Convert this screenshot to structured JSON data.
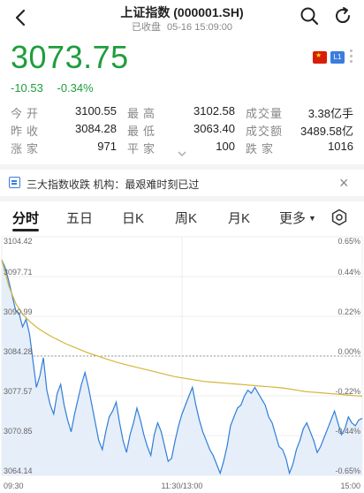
{
  "header": {
    "title": "上证指数 (000001.SH)",
    "status": "已收盘",
    "datetime": "05-16 15:09:00"
  },
  "quote": {
    "price": "3073.75",
    "change": "-10.53",
    "change_pct": "-0.34%",
    "badge_level": "L1"
  },
  "stats": [
    {
      "l1": "今开",
      "v1": "3100.55",
      "l2": "最高",
      "v2": "3102.58",
      "l3": "成交量",
      "v3": "3.38亿手"
    },
    {
      "l1": "昨收",
      "v1": "3084.28",
      "l2": "最低",
      "v2": "3063.40",
      "l3": "成交额",
      "v3": "3489.58亿"
    },
    {
      "l1": "涨家",
      "v1": "971",
      "l2": "平家",
      "v2": "100",
      "l3": "跌家",
      "v3": "1016"
    }
  ],
  "news": {
    "text": "三大指数收跌 机构：最艰难时刻已过"
  },
  "tabs": [
    "分时",
    "五日",
    "日K",
    "周K",
    "月K",
    "更多"
  ],
  "colors": {
    "down": "#1e9e3c",
    "price_line": "#2f7ed8",
    "avg_line": "#d4b63a",
    "fill": "#e6eef9"
  },
  "chart_data": {
    "type": "line",
    "y_left_ticks": [
      "3104.42",
      "3097.71",
      "3090.99",
      "3084.28",
      "3077.57",
      "3070.85",
      "3064.14"
    ],
    "y_right_ticks": [
      "0.65%",
      "0.44%",
      "0.22%",
      "0.00%",
      "-0.22%",
      "-0.44%",
      "-0.65%"
    ],
    "x_ticks": [
      "09:30",
      "11:30/13:00",
      "15:00"
    ],
    "ylim": [
      3064.14,
      3104.42
    ],
    "prev_close": 3084.28,
    "series": [
      {
        "values": [
          3100.5,
          3099.2,
          3097.0,
          3094.5,
          3092.0,
          3091.5,
          3089.2,
          3090.5,
          3088.0,
          3083.5,
          3079.0,
          3081.0,
          3084.0,
          3078.5,
          3076.0,
          3074.5,
          3078.0,
          3079.5,
          3076.0,
          3073.5,
          3071.5,
          3074.5,
          3077.0,
          3079.5,
          3081.5,
          3079.0,
          3076.0,
          3073.0,
          3070.0,
          3068.5,
          3071.5,
          3074.0,
          3075.0,
          3076.5,
          3073.0,
          3070.0,
          3068.0,
          3071.0,
          3073.0,
          3075.5,
          3073.5,
          3071.0,
          3069.0,
          3067.5,
          3071.0,
          3073.0,
          3071.5,
          3069.0,
          3066.5,
          3067.0,
          3070.0,
          3072.5,
          3074.5,
          3076.0,
          3077.5,
          3079.0,
          3076.0,
          3073.5,
          3071.5,
          3070.0,
          3068.5,
          3067.5,
          3066.0,
          3064.5,
          3066.5,
          3069.0,
          3072.5,
          3074.0,
          3075.5,
          3076.0,
          3077.5,
          3078.5,
          3078.0,
          3079.0,
          3078.0,
          3077.0,
          3076.0,
          3074.0,
          3073.0,
          3071.0,
          3069.0,
          3068.5,
          3067.0,
          3064.5,
          3066.0,
          3068.5,
          3070.0,
          3072.0,
          3073.0,
          3071.5,
          3070.0,
          3068.0,
          3069.0,
          3070.5,
          3072.0,
          3073.5,
          3075.0,
          3073.0,
          3071.0,
          3072.0,
          3074.0,
          3073.0,
          3072.5,
          3073.5,
          3073.75
        ],
        "color": "#2f7ed8"
      },
      {
        "values": [
          3100.5,
          3096.0,
          3093.0,
          3091.2,
          3090.0,
          3089.0,
          3088.2,
          3087.5,
          3086.9,
          3086.3,
          3085.8,
          3085.3,
          3084.8,
          3084.4,
          3084.0,
          3083.6,
          3083.2,
          3082.9,
          3082.6,
          3082.3,
          3082.0,
          3081.7,
          3081.4,
          3081.1,
          3080.8,
          3080.6,
          3080.4,
          3080.2,
          3080.0,
          3079.9,
          3079.8,
          3079.7,
          3079.6,
          3079.5,
          3079.4,
          3079.3,
          3079.2,
          3079.1,
          3079.0,
          3078.9,
          3078.7,
          3078.5,
          3078.3,
          3078.2,
          3078.1,
          3078.0,
          3077.9,
          3077.8,
          3077.7,
          3077.6,
          3077.5
        ],
        "color": "#d4b63a"
      }
    ]
  }
}
